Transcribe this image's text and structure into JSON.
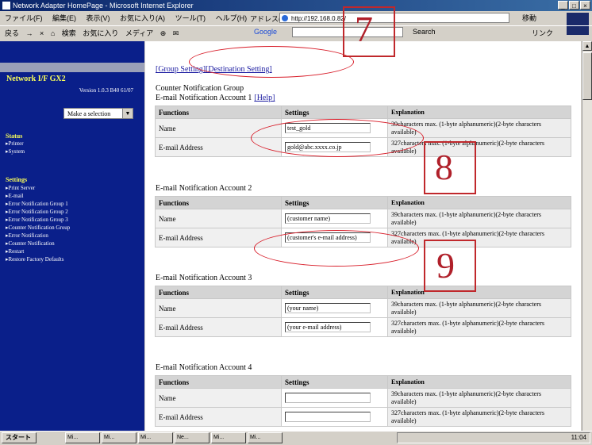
{
  "window": {
    "title": "Network Adapter HomePage - Microsoft Internet Explorer",
    "buttons": [
      "_",
      "□",
      "×"
    ]
  },
  "menubar": {
    "items": [
      "ファイル(F)",
      "編集(E)",
      "表示(V)",
      "お気に入り(A)",
      "ツール(T)",
      "ヘルプ(H)"
    ]
  },
  "address": {
    "label": "アドレス(D)",
    "value": "http://192.168.0.82/",
    "go": "移動"
  },
  "toolbar": {
    "items": [
      "戻る",
      "→",
      "×",
      "⌂",
      "検索",
      "お気に入り",
      "メディア",
      "⊕",
      "✉"
    ],
    "google_label": "Google",
    "search_label": "Search",
    "right_label": "リンク"
  },
  "sidebar": {
    "brand": "Network I/F GX2",
    "version": "Version 1.0.3 B40 61/07",
    "select_value": "Make a selection",
    "status_heading": "Status",
    "status_links": [
      "Printer",
      "System"
    ],
    "settings_heading": "Settings",
    "settings_links": [
      "Print Server",
      "E-mail",
      "Error Notification Group 1",
      "Error Notification Group 2",
      "Error Notification Group 3",
      "Counter Notification Group",
      "Error Notification",
      "Counter Notification",
      "Restart",
      "Restore Factory Defaults"
    ]
  },
  "content": {
    "breadcrumb": "[Group Setting][Destination Setting]",
    "group_title": "Counter Notification Group",
    "help_label": "[Help]",
    "headers": {
      "functions": "Functions",
      "settings": "Settings",
      "explanation": "Explanation"
    },
    "accounts": [
      {
        "title": "E-mail Notification Account 1",
        "name_label": "Name",
        "name_value": "test_gold",
        "email_label": "E-mail Address",
        "email_value": "gold@abc.xxxx.co.jp",
        "name_explanation": "39characters max. (1-byte alphanumeric)(2-byte characters available)",
        "email_explanation": "327characters max. (1-byte alphanumeric)(2-byte characters available)"
      },
      {
        "title": "E-mail Notification Account 2",
        "name_label": "Name",
        "name_value": "(customer name)",
        "email_label": "E-mail Address",
        "email_value": "(customer's e-mail address)",
        "name_explanation": "39characters max. (1-byte alphanumeric)(2-byte characters available)",
        "email_explanation": "327characters max. (1-byte alphanumeric)(2-byte characters available)"
      },
      {
        "title": "E-mail Notification Account 3",
        "name_label": "Name",
        "name_value": "(your name)",
        "email_label": "E-mail Address",
        "email_value": "(your e-mail address)",
        "name_explanation": "39characters max. (1-byte alphanumeric)(2-byte characters available)",
        "email_explanation": "327characters max. (1-byte alphanumeric)(2-byte characters available)"
      },
      {
        "title": "E-mail Notification Account 4",
        "name_label": "Name",
        "name_value": "",
        "email_label": "E-mail Address",
        "email_value": "",
        "name_explanation": "39characters max. (1-byte alphanumeric)(2-byte characters available)",
        "email_explanation": "327characters max. (1-byte alphanumeric)(2-byte characters available)"
      }
    ]
  },
  "annotations": {
    "num_7": "7",
    "num_8": "8",
    "num_9": "9",
    "color": "#c0282c"
  },
  "taskbar": {
    "start": "スタート",
    "tasks": [
      "Mi...",
      "Mi...",
      "Mi...",
      "Ne...",
      "Mi...",
      "Mi..."
    ],
    "clock": "11:04"
  }
}
